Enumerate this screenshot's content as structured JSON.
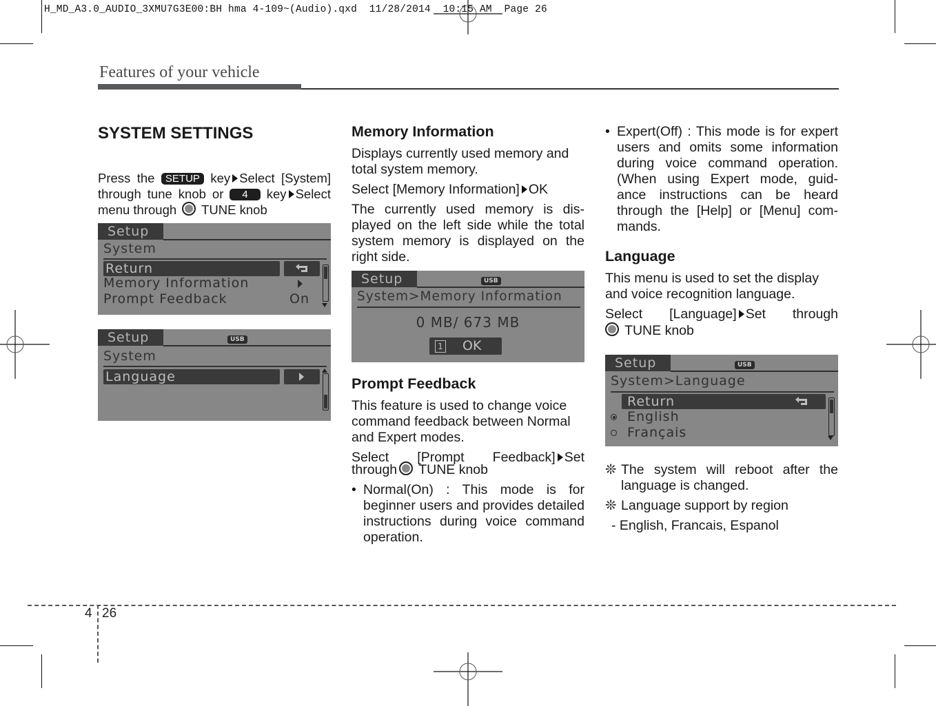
{
  "print_slug": "H_MD_A3.0_AUDIO_3XMU7G3E00:BH hma 4-109~(Audio).qxd  11/28/2014  10:15 AM  Page 26",
  "running_header": "Features of your vehicle",
  "footer": {
    "chapter": "4",
    "page": "26"
  },
  "col1": {
    "title": "SYSTEM SETTINGS",
    "intro": {
      "t1": "Press the ",
      "key_setup": "SETUP",
      "t2": " key",
      "t3": "Select [System] through tune knob or ",
      "key_num": "4",
      "t4": "  key",
      "t5": "Select menu through ",
      "t6": " TUNE knob"
    },
    "screen1": {
      "tab": "Setup",
      "crumb": "System",
      "rows": [
        "Return",
        "Memory Information",
        "Prompt Feedback"
      ],
      "prompt_value": "On",
      "return_icon": "return-arrow-icon"
    },
    "screen2": {
      "tab": "Setup",
      "usb": "USB",
      "crumb": "System",
      "rows": [
        "Language"
      ]
    }
  },
  "col2": {
    "mem_title": "Memory Information",
    "mem_p1": "Displays currently used memory and total system memory.",
    "mem_select_a": "Select [Memory Information]",
    "mem_select_b": "OK",
    "mem_p2": "The currently used memory is dis-played on the left side while the total system memory is displayed on the right side.",
    "screen3": {
      "tab": "Setup",
      "usb": "USB",
      "crumb": "System>Memory Information",
      "memory_used": "0 MB",
      "memory_total": "673 MB",
      "memory_text": "0 MB/ 673 MB",
      "ok_index": "1",
      "ok_label": "OK"
    },
    "pf_title": "Prompt Feedback",
    "pf_p1": "This feature is used to change voice command feedback between Normal and Expert modes.",
    "pf_select_a": "Select [Prompt Feedback]",
    "pf_select_b": "Set through",
    "pf_select_c": " TUNE knob",
    "pf_bullet1": "Normal(On) : This mode is for beginner users and provides detailed instructions during voice command operation."
  },
  "col3": {
    "pf_bullet2": "Expert(Off) : This mode is for expert users and omits some information during voice command operation. (When using Expert mode, guid-ance instructions can be heard through the [Help] or [Menu] com-mands.",
    "lang_title": "Language",
    "lang_p1": "This menu is used to set the display and voice recognition language.",
    "lang_select_a": "Select [Language]",
    "lang_select_b": "Set through",
    "lang_select_c": " TUNE knob",
    "screen4": {
      "tab": "Setup",
      "usb": "USB",
      "crumb": "System>Language",
      "return_label": "Return",
      "options": [
        {
          "label": "English",
          "selected": true
        },
        {
          "label": "Français",
          "selected": false
        }
      ]
    },
    "note_symbol": "❊",
    "note1": "The system will reboot after the language is changed.",
    "note2": "Language support by region",
    "note2_sub": "- English, Francais, Espanol"
  },
  "colors": {
    "lcd_bg": "#878787",
    "lcd_dark": "#3a3a3a",
    "header_bar": "#58595b"
  }
}
